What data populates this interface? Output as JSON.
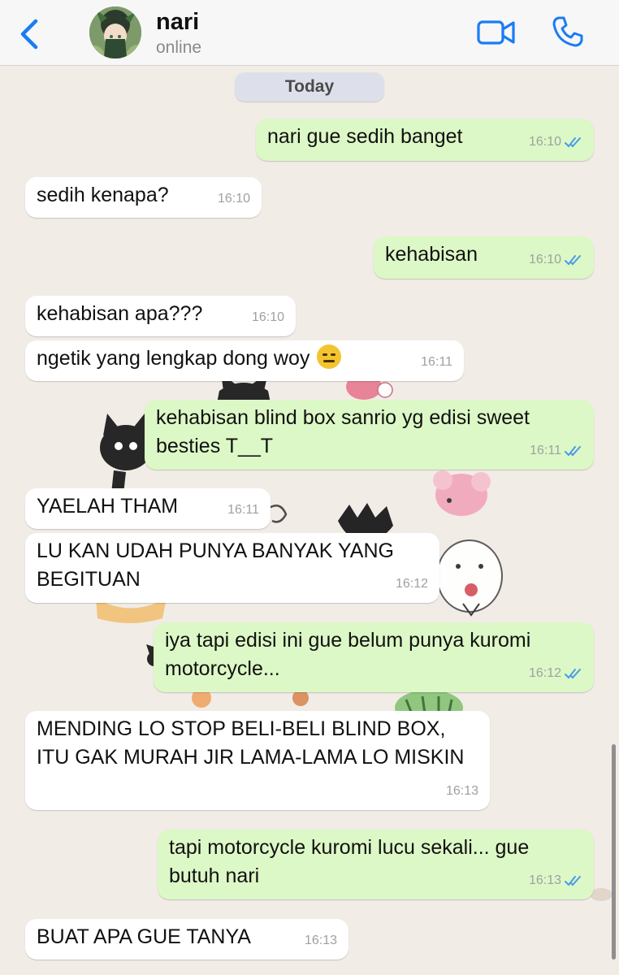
{
  "header": {
    "contact_name": "nari",
    "status": "online"
  },
  "icons": {
    "back": "chevron-left-icon",
    "video": "video-camera-icon",
    "call": "phone-icon",
    "read": "double-check-icon"
  },
  "colors": {
    "accent": "#1a7cf5",
    "outgoing_bubble": "#dcf8c6",
    "incoming_bubble": "#ffffff",
    "read_ticks": "#4a9be8",
    "wallpaper": "#f1ece6"
  },
  "chat": {
    "date_label": "Today",
    "messages": [
      {
        "direction": "out",
        "text": "nari gue sedih banget",
        "time": "16:10",
        "read": true
      },
      {
        "direction": "in",
        "text": "sedih kenapa?",
        "time": "16:10"
      },
      {
        "direction": "out",
        "text": "kehabisan",
        "time": "16:10",
        "read": true
      },
      {
        "direction": "in",
        "text": "kehabisan apa???",
        "time": "16:10"
      },
      {
        "direction": "in",
        "text": "ngetik yang lengkap dong woy",
        "emoji": "expressionless-face",
        "time": "16:11"
      },
      {
        "direction": "out",
        "text": "kehabisan blind box sanrio yg edisi sweet besties T__T",
        "time": "16:11",
        "read": true
      },
      {
        "direction": "in",
        "text": "YAELAH THAM",
        "time": "16:11"
      },
      {
        "direction": "in",
        "text": "LU KAN UDAH PUNYA BANYAK YANG BEGITUAN",
        "time": "16:12"
      },
      {
        "direction": "out",
        "text": "iya tapi edisi ini gue belum punya kuromi motorcycle...",
        "time": "16:12",
        "read": true
      },
      {
        "direction": "in",
        "text": "MENDING LO STOP BELI-BELI BLIND BOX, ITU GAK MURAH JIR LAMA-LAMA LO MISKIN",
        "time": "16:13"
      },
      {
        "direction": "out",
        "text": "tapi motorcycle kuromi lucu sekali... gue butuh nari",
        "time": "16:13",
        "read": true
      },
      {
        "direction": "in",
        "text": "BUAT APA GUE TANYA",
        "time": "16:13"
      }
    ]
  }
}
